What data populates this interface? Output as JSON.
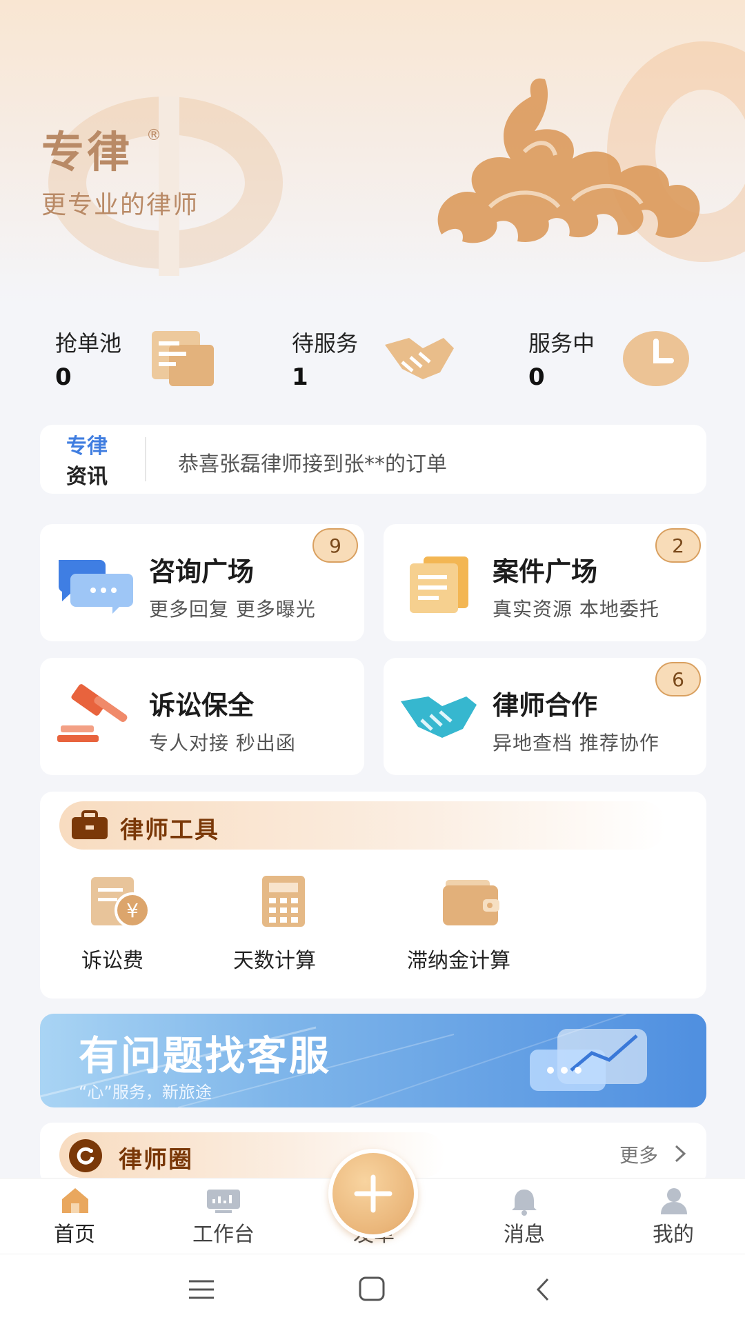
{
  "brand": {
    "title": "专律",
    "registered": "®",
    "slogan": "更专业的律师"
  },
  "stats": [
    {
      "label": "抢单池",
      "value": "0",
      "icon": "document-icon"
    },
    {
      "label": "待服务",
      "value": "1",
      "icon": "handshake-icon"
    },
    {
      "label": "服务中",
      "value": "0",
      "icon": "clock-icon"
    }
  ],
  "news": {
    "brand_line1": "专律",
    "brand_line2": "资讯",
    "text": "恭喜张磊律师接到张**的订单"
  },
  "tiles": [
    {
      "title": "咨询广场",
      "subtitle": "更多回复 更多曝光",
      "badge": "9",
      "icon": "chat-bubbles-icon"
    },
    {
      "title": "案件广场",
      "subtitle": "真实资源 本地委托",
      "badge": "2",
      "icon": "documents-icon"
    },
    {
      "title": "诉讼保全",
      "subtitle": "专人对接 秒出函",
      "badge": "",
      "icon": "gavel-icon"
    },
    {
      "title": "律师合作",
      "subtitle": "异地查档 推荐协作",
      "badge": "6",
      "icon": "handshake-icon"
    }
  ],
  "tools": {
    "title": "律师工具",
    "items": [
      {
        "label": "诉讼费",
        "icon": "fee-icon"
      },
      {
        "label": "天数计算",
        "icon": "calculator-icon"
      },
      {
        "label": "滞纳金计算",
        "icon": "wallet-icon"
      }
    ]
  },
  "banner": {
    "title": "有问题找客服",
    "subtitle": "“心”服务，新旅途"
  },
  "circle": {
    "title": "律师圈",
    "more": "更多"
  },
  "tabbar": {
    "items": [
      {
        "label": "首页",
        "icon": "home-icon"
      },
      {
        "label": "工作台",
        "icon": "monitor-icon"
      },
      {
        "label": "发单",
        "icon": "plus-icon"
      },
      {
        "label": "消息",
        "icon": "bell-icon"
      },
      {
        "label": "我的",
        "icon": "user-icon"
      }
    ]
  },
  "colors": {
    "accent": "#e8b47a",
    "brand_text": "#b98a66",
    "title_brown": "#7a3808",
    "banner_blue": "#4f8fe0"
  }
}
